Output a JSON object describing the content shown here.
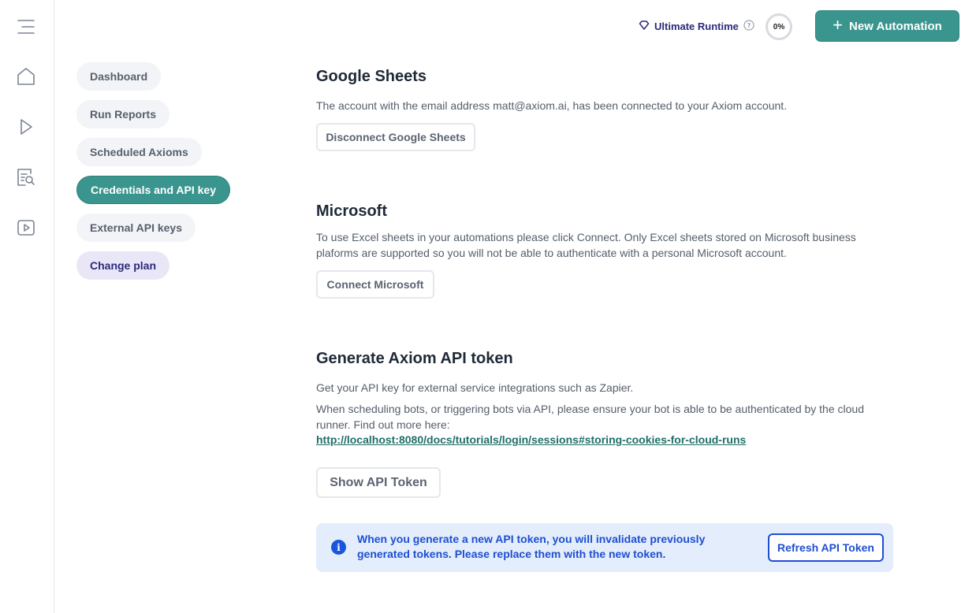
{
  "rail": {
    "icons": [
      "menu-icon",
      "home-icon",
      "play-icon",
      "report-search-icon",
      "video-icon"
    ]
  },
  "topbar": {
    "runtime_label": "Ultimate Runtime",
    "usage_percent": "0%",
    "new_automation_label": "New Automation",
    "accent_color": "#3a958f"
  },
  "nav": {
    "items": [
      {
        "label": "Dashboard"
      },
      {
        "label": "Run Reports"
      },
      {
        "label": "Scheduled Axioms"
      },
      {
        "label": "Credentials and API key"
      },
      {
        "label": "External API keys"
      },
      {
        "label": "Change plan"
      }
    ],
    "active_index": 3
  },
  "google": {
    "title": "Google Sheets",
    "description": "The account with the email address matt@axiom.ai, has been connected to your Axiom account.",
    "button": "Disconnect Google Sheets"
  },
  "microsoft": {
    "title": "Microsoft",
    "description": "To use Excel sheets in your automations please click Connect. Only Excel sheets stored on Microsoft business plaforms are supported so you will not be able to authenticate with a personal Microsoft account.",
    "button": "Connect Microsoft"
  },
  "api": {
    "title": "Generate Axiom API token",
    "description1": "Get your API key for external service integrations such as Zapier.",
    "description2": "When scheduling bots, or triggering bots via API, please ensure your bot is able to be authenticated by the cloud runner. Find out more here:",
    "link": "http://localhost:8080/docs/tutorials/login/sessions#storing-cookies-for-cloud-runs",
    "show_button": "Show API Token",
    "info_message": "When you generate a new API token, you will invalidate previously generated tokens. Please replace them with the new token.",
    "refresh_button": "Refresh API Token"
  }
}
